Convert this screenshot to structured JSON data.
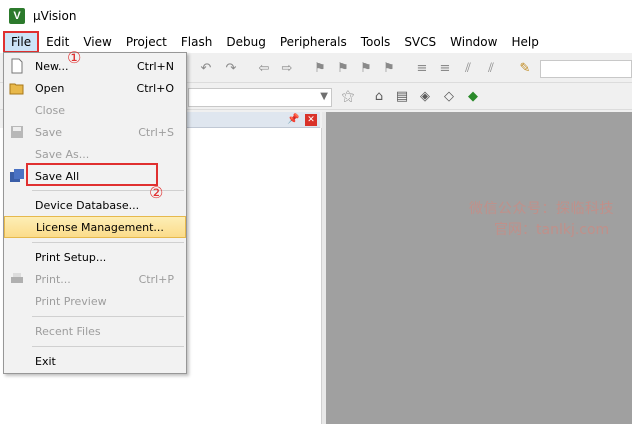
{
  "window": {
    "title": "µVision",
    "icon_letter": "V"
  },
  "menubar": [
    "File",
    "Edit",
    "View",
    "Project",
    "Flash",
    "Debug",
    "Peripherals",
    "Tools",
    "SVCS",
    "Window",
    "Help"
  ],
  "file_menu": {
    "new": {
      "label": "New...",
      "shortcut": "Ctrl+N"
    },
    "open": {
      "label": "Open",
      "shortcut": "Ctrl+O"
    },
    "close": {
      "label": "Close"
    },
    "save": {
      "label": "Save",
      "shortcut": "Ctrl+S"
    },
    "save_as": {
      "label": "Save As..."
    },
    "save_all": {
      "label": "Save All"
    },
    "device_database": {
      "label": "Device Database..."
    },
    "license_management": {
      "label": "License Management..."
    },
    "print_setup": {
      "label": "Print Setup..."
    },
    "print": {
      "label": "Print...",
      "shortcut": "Ctrl+P"
    },
    "print_preview": {
      "label": "Print Preview"
    },
    "recent_files": {
      "label": "Recent Files"
    },
    "exit": {
      "label": "Exit"
    }
  },
  "annotations": {
    "step1": "①",
    "step2": "②"
  },
  "watermark": {
    "line1": "微信公众号：探临科技",
    "line2": "官网：tanlkj.com"
  },
  "colors": {
    "highlight": "#fbdc8a",
    "annotation": "#e03030",
    "editor_bg": "#a0a0a0"
  },
  "toolbar_icons": [
    "new-file-icon",
    "undo-icon",
    "redo-icon",
    "back-icon",
    "forward-icon",
    "bookmark-icon",
    "indent-icon",
    "outdent-icon",
    "comment-icon",
    "find-icon",
    "build-icon",
    "rebuild-icon",
    "options-icon",
    "download-icon",
    "manage-icon"
  ]
}
